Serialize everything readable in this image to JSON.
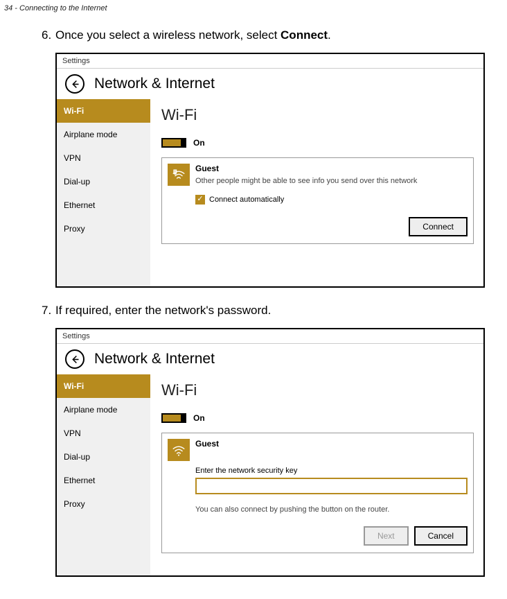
{
  "pageHeader": "34 - Connecting to the Internet",
  "step6_num": "6.",
  "step6_text_a": "Once you select a wireless network, select ",
  "step6_bold": "Connect",
  "step6_text_b": ".",
  "step7_num": "7.",
  "step7_text": "If required, enter the network's password.",
  "ss": {
    "titlebar": "Settings",
    "headerTitle": "Network & Internet",
    "sidebar": {
      "wifi": "Wi-Fi",
      "airplane": "Airplane mode",
      "vpn": "VPN",
      "dialup": "Dial-up",
      "ethernet": "Ethernet",
      "proxy": "Proxy"
    },
    "mainTitle": "Wi-Fi",
    "toggleLabel": "On",
    "netName": "Guest",
    "netDesc1": "Other people might be able to see info you send over this network",
    "chkLabel": "Connect automatically",
    "connectBtn": "Connect",
    "keyPrompt": "Enter the network security key",
    "routerNote": "You can also connect by pushing the button on the router.",
    "nextBtn": "Next",
    "cancelBtn": "Cancel"
  }
}
